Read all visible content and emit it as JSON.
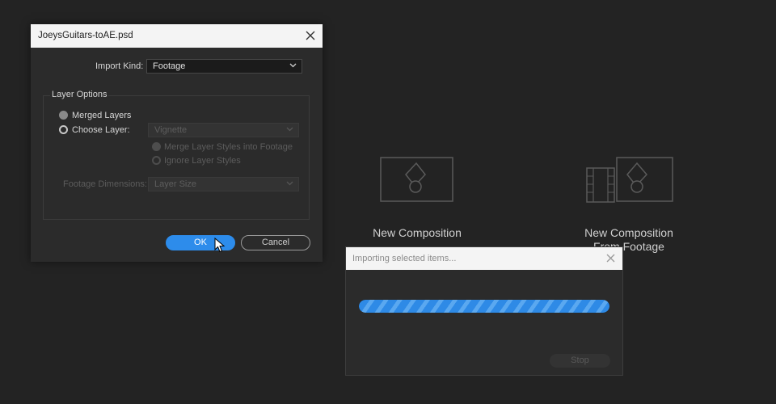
{
  "background": {
    "new_composition_label": "New Composition",
    "new_comp_from_footage_line1": "New Composition",
    "new_comp_from_footage_line2": "From Footage"
  },
  "import_dialog": {
    "title": "JoeysGuitars-toAE.psd",
    "import_kind_label": "Import Kind:",
    "import_kind_value": "Footage",
    "layer_options_title": "Layer Options",
    "merged_layers_label": "Merged Layers",
    "choose_layer_label": "Choose Layer:",
    "choose_layer_value": "Vignette",
    "merge_styles_label": "Merge Layer Styles into Footage",
    "ignore_styles_label": "Ignore Layer Styles",
    "footage_dimensions_label": "Footage Dimensions:",
    "footage_dimensions_value": "Layer Size",
    "ok_label": "OK",
    "cancel_label": "Cancel",
    "selected_option": "Merged Layers"
  },
  "progress_dialog": {
    "title": "Importing selected items...",
    "stop_label": "Stop",
    "progress": 1.0
  },
  "colors": {
    "accent": "#2d8ceb",
    "background": "#232323",
    "dialog": "#2b2b2b"
  }
}
